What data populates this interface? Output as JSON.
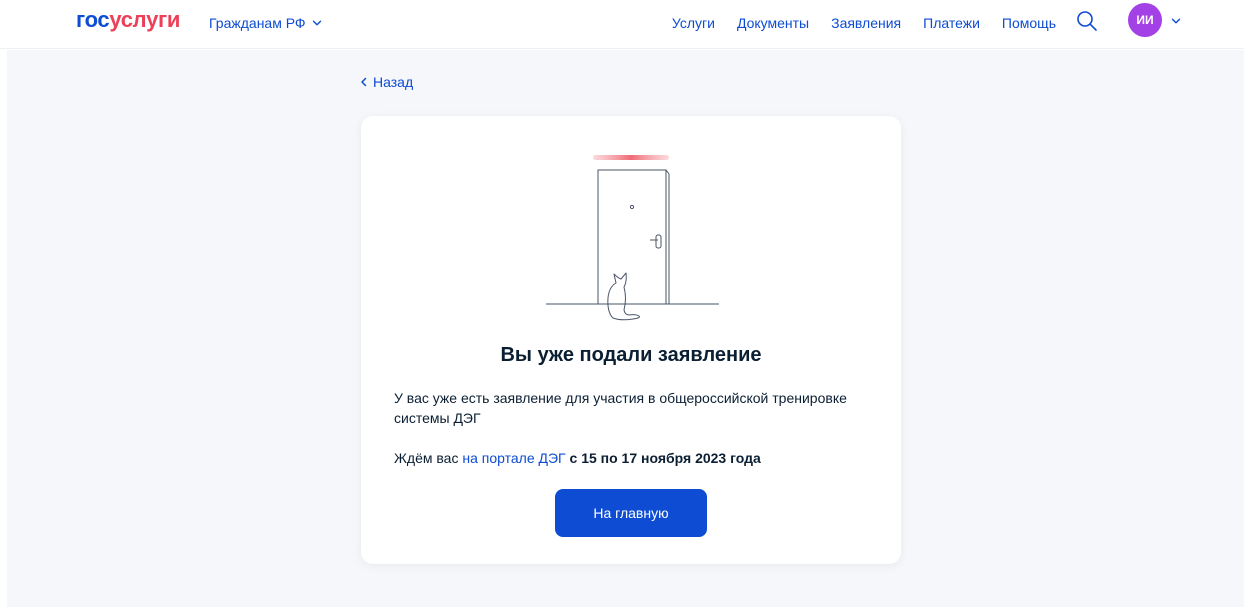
{
  "header": {
    "logo_gos": "гос",
    "logo_uslugi": "услуги",
    "region_label": "Гражданам РФ",
    "nav": {
      "services": "Услуги",
      "documents": "Документы",
      "applications": "Заявления",
      "payments": "Платежи",
      "help": "Помощь"
    },
    "avatar_initials": "ИИ",
    "search_icon": "search-icon",
    "avatar_color": "#a340e6",
    "brand_color": "#0d4cd3",
    "logo_accent_color": "#ee3f58"
  },
  "main": {
    "back_label": "Назад",
    "card": {
      "title": "Вы уже подали заявление",
      "text": "У вас уже есть заявление для участия в общероссийской тренировке системы ДЭГ",
      "wait_prefix": "Ждём вас ",
      "wait_link": "на портале ДЭГ",
      "wait_dates": " с 15 по 17 ноября 2023 года",
      "button_label": "На главную",
      "illustration": "door-with-cat-illustration"
    }
  }
}
